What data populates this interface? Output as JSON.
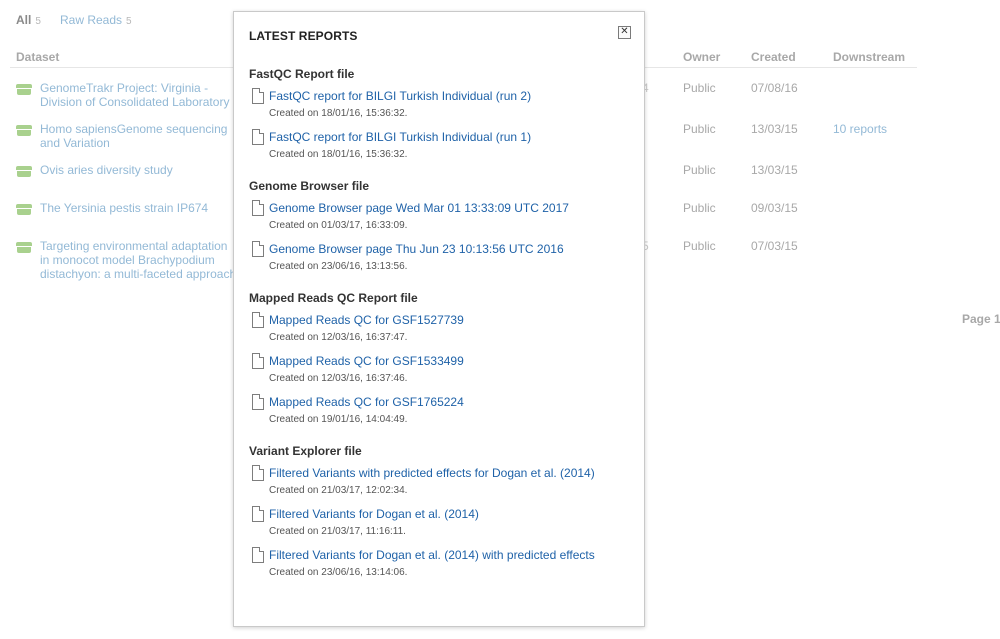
{
  "filters": [
    {
      "label": "All",
      "count": "5"
    },
    {
      "label": "Raw Reads",
      "count": "5"
    }
  ],
  "table": {
    "headers": {
      "dataset": "Dataset",
      "owner": "Owner",
      "created": "Created",
      "downstream": "Downstream"
    },
    "rows": [
      {
        "title": "GenomeTrakr Project: Virginia - Division of Consolidated Laboratory Services",
        "stub": "4",
        "owner": "Public",
        "created": "07/08/16",
        "downstream": ""
      },
      {
        "title": "Homo sapiensGenome sequencing and Variation",
        "stub": "",
        "owner": "Public",
        "created": "13/03/15",
        "downstream": "10 reports"
      },
      {
        "title": "Ovis aries diversity study",
        "stub": "",
        "owner": "Public",
        "created": "13/03/15",
        "downstream": ""
      },
      {
        "title": "The Yersinia pestis strain IP674 genome",
        "stub": "",
        "owner": "Public",
        "created": "09/03/15",
        "downstream": ""
      },
      {
        "title": "Targeting environmental adaptation in monocot model Brachypodium distachyon: a multi-faceted approach",
        "stub": "5",
        "owner": "Public",
        "created": "07/03/15",
        "downstream": ""
      }
    ]
  },
  "pagination": {
    "label": "Page 1"
  },
  "modal": {
    "title": "LATEST REPORTS",
    "close_icon": "close-icon",
    "sections": [
      {
        "title": "FastQC Report file",
        "reports": [
          {
            "name": "FastQC report for BILGI Turkish Individual (run 2)",
            "created": "Created on 18/01/16, 15:36:32."
          },
          {
            "name": "FastQC report for BILGI Turkish Individual (run 1)",
            "created": "Created on 18/01/16, 15:36:32."
          }
        ]
      },
      {
        "title": "Genome Browser file",
        "reports": [
          {
            "name": "Genome Browser page Wed Mar 01 13:33:09 UTC 2017",
            "created": "Created on 01/03/17, 16:33:09."
          },
          {
            "name": "Genome Browser page Thu Jun 23 10:13:56 UTC 2016",
            "created": "Created on 23/06/16, 13:13:56."
          }
        ]
      },
      {
        "title": "Mapped Reads QC Report file",
        "reports": [
          {
            "name": "Mapped Reads QC for GSF1527739",
            "created": "Created on 12/03/16, 16:37:47."
          },
          {
            "name": "Mapped Reads QC for GSF1533499",
            "created": "Created on 12/03/16, 16:37:46."
          },
          {
            "name": "Mapped Reads QC for GSF1765224",
            "created": "Created on 19/01/16, 14:04:49."
          }
        ]
      },
      {
        "title": "Variant Explorer file",
        "reports": [
          {
            "name": "Filtered Variants with predicted effects for Dogan et al. (2014)",
            "created": "Created on 21/03/17, 12:02:34."
          },
          {
            "name": "Filtered Variants for Dogan et al. (2014)",
            "created": "Created on 21/03/17, 11:16:11."
          },
          {
            "name": "Filtered Variants for Dogan et al. (2014) with predicted effects",
            "created": "Created on 23/06/16, 13:14:06."
          }
        ]
      }
    ]
  },
  "colors": {
    "link": "#1f62a8",
    "faded_link": "#93b9d6",
    "dataset_icon": "#a9d18e"
  },
  "icons": {
    "dataset": "dataset-icon",
    "report": "document-icon"
  }
}
